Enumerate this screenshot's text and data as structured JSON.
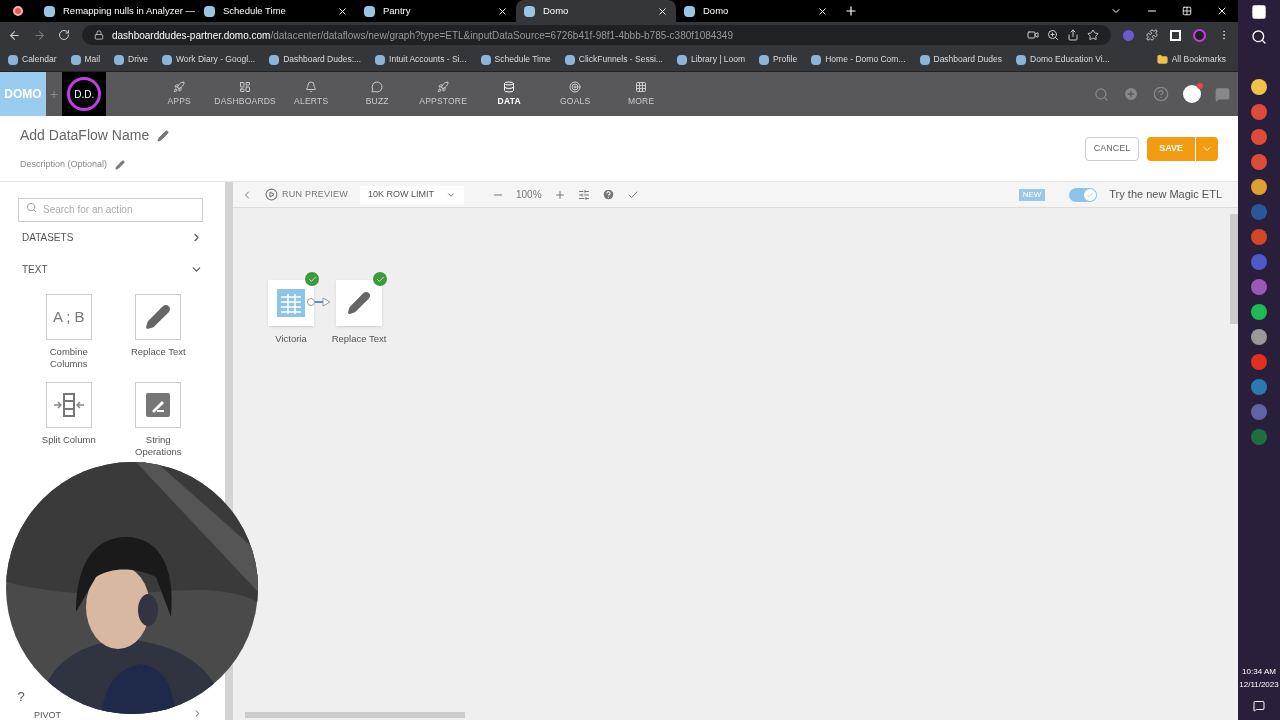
{
  "browser": {
    "tabs": [
      {
        "title": "Remapping nulls in Analyzer —",
        "selected": false
      },
      {
        "title": "Schedule Time",
        "selected": false
      },
      {
        "title": "Pantry",
        "selected": false
      },
      {
        "title": "Domo",
        "selected": true
      },
      {
        "title": "Domo",
        "selected": false
      }
    ],
    "url": {
      "host": "dashboarddudes-partner.domo.com",
      "path": "/datacenter/dataflows/new/graph?type=ETL&inputDataSource=6726b41f-98f1-4bbb-b785-c380f1084349"
    },
    "bookmarks": [
      "Calendar",
      "Mail",
      "Drive",
      "Work Diary - Googl...",
      "Dashboard Dudes:...",
      "Intuit Accounts - Si...",
      "Schedule Time",
      "ClickFunnels - Sessi...",
      "Library | Loom",
      "Profile",
      "Home - Domo Com...",
      "Dashboard Dudes",
      "Domo Education Vi..."
    ],
    "all_bookmarks": "All Bookmarks"
  },
  "domo": {
    "logo": "DOMO",
    "plus": "+",
    "badge": "D.D.",
    "nav": [
      {
        "label": "APPS",
        "selected": false
      },
      {
        "label": "DASHBOARDS",
        "selected": false
      },
      {
        "label": "ALERTS",
        "selected": false
      },
      {
        "label": "BUZZ",
        "selected": false
      },
      {
        "label": "APPSTORE",
        "selected": false
      },
      {
        "label": "DATA",
        "selected": true
      },
      {
        "label": "GOALS",
        "selected": false
      },
      {
        "label": "MORE",
        "selected": false
      }
    ]
  },
  "header": {
    "title": "Add DataFlow Name",
    "description": "Description (Optional)",
    "cancel": "CANCEL",
    "save": "SAVE"
  },
  "sidebar": {
    "search": {
      "placeholder": "Search for an action"
    },
    "sections": [
      {
        "label": "DATASETS",
        "expanded": false
      },
      {
        "label": "TEXT",
        "expanded": true
      }
    ],
    "tiles": [
      {
        "label": "Combine Columns",
        "kind": "text",
        "glyph": "A ; B"
      },
      {
        "label": "Replace Text",
        "kind": "pencil"
      },
      {
        "label": "Split Column",
        "kind": "split"
      },
      {
        "label": "String Operations",
        "kind": "string"
      }
    ],
    "bottom_section": {
      "label": "PIVOT",
      "expanded": false
    },
    "help": "?"
  },
  "toolbar": {
    "run_preview": "RUN PREVIEW",
    "row_limit": "10K ROW LIMIT",
    "zoom": "100%",
    "badge": "NEW",
    "toggle": {
      "label": "Try the new Magic ETL",
      "on": true
    }
  },
  "canvas": {
    "nodes": [
      {
        "label": "Victoria",
        "kind": "table",
        "valid": true
      },
      {
        "label": "Replace Text",
        "kind": "pencil",
        "valid": true
      }
    ]
  },
  "taskbar": {
    "time": "10:34 AM",
    "date": "12/11/2023"
  }
}
